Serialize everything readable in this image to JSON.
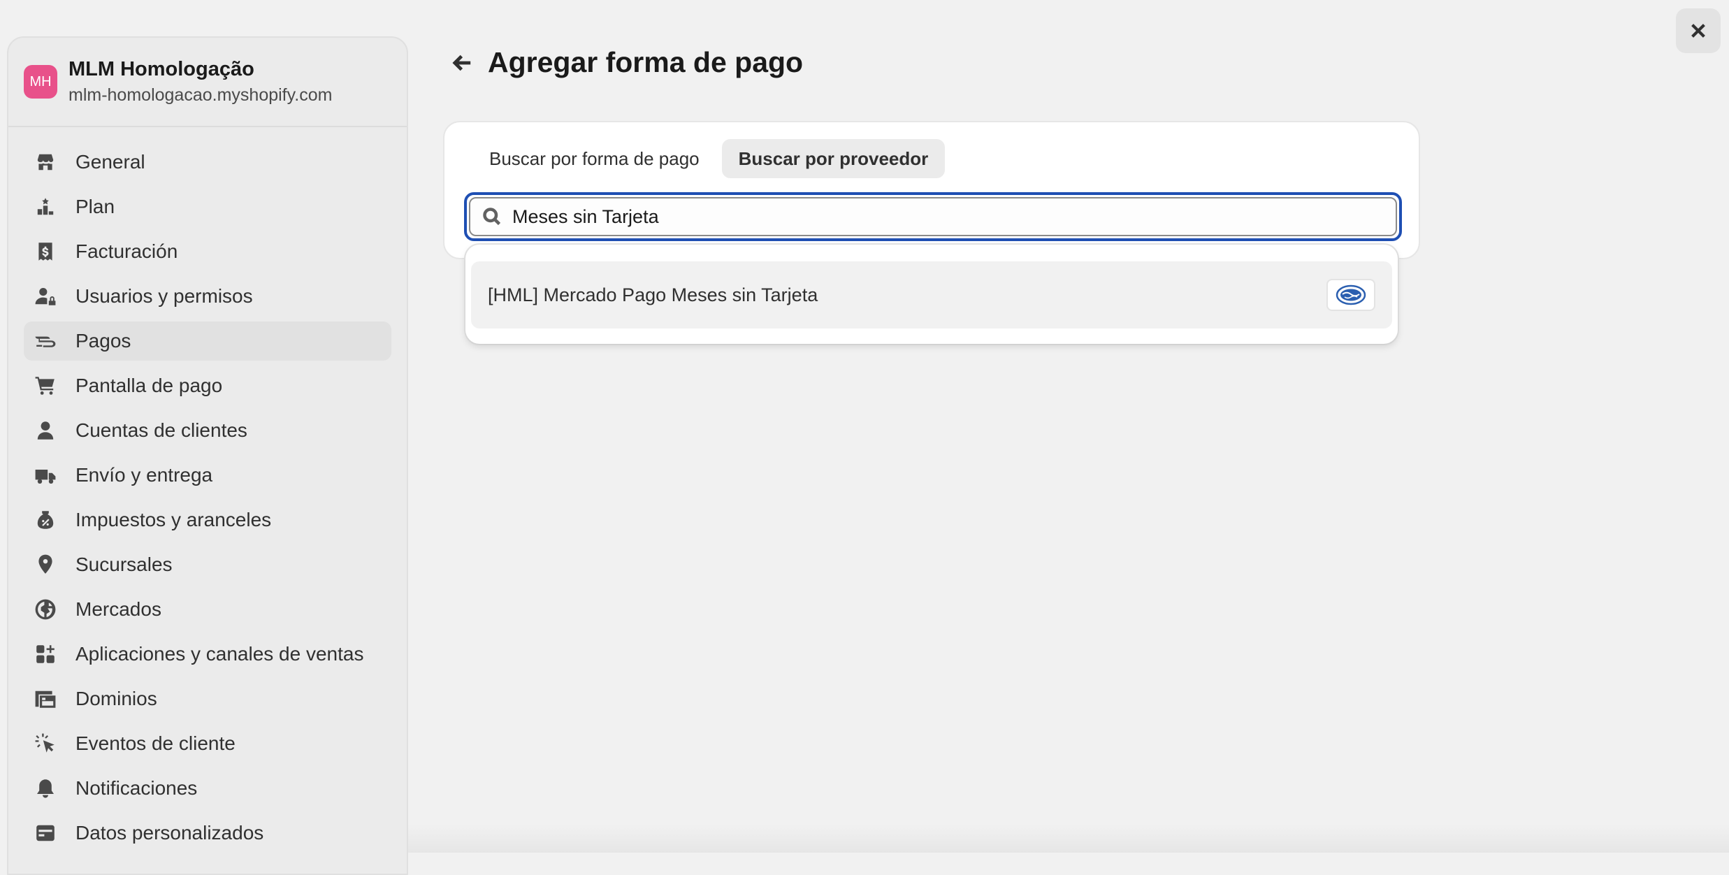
{
  "store": {
    "avatar_initials": "MH",
    "name": "MLM Homologação",
    "domain": "mlm-homologacao.myshopify.com",
    "avatar_color": "#e8518a"
  },
  "sidebar": {
    "items": [
      {
        "label": "General",
        "icon": "store-icon"
      },
      {
        "label": "Plan",
        "icon": "plan-icon"
      },
      {
        "label": "Facturación",
        "icon": "billing-icon"
      },
      {
        "label": "Usuarios y permisos",
        "icon": "users-icon"
      },
      {
        "label": "Pagos",
        "icon": "payments-icon",
        "active": true
      },
      {
        "label": "Pantalla de pago",
        "icon": "cart-icon"
      },
      {
        "label": "Cuentas de clientes",
        "icon": "person-icon"
      },
      {
        "label": "Envío y entrega",
        "icon": "truck-icon"
      },
      {
        "label": "Impuestos y aranceles",
        "icon": "tax-icon"
      },
      {
        "label": "Sucursales",
        "icon": "location-icon"
      },
      {
        "label": "Mercados",
        "icon": "globe-icon"
      },
      {
        "label": "Aplicaciones y canales de ventas",
        "icon": "apps-icon"
      },
      {
        "label": "Dominios",
        "icon": "domains-icon"
      },
      {
        "label": "Eventos de cliente",
        "icon": "cursor-icon"
      },
      {
        "label": "Notificaciones",
        "icon": "bell-icon"
      },
      {
        "label": "Datos personalizados",
        "icon": "data-icon"
      }
    ]
  },
  "header": {
    "title": "Agregar forma de pago"
  },
  "tabs": [
    {
      "label": "Buscar por forma de pago",
      "active": false
    },
    {
      "label": "Buscar por proveedor",
      "active": true
    }
  ],
  "search": {
    "value": "Meses sin Tarjeta",
    "focus_color": "#1f4fb3"
  },
  "results": [
    {
      "label": "[HML] Mercado Pago Meses sin Tarjeta",
      "logo": "mercado-pago-logo"
    }
  ]
}
